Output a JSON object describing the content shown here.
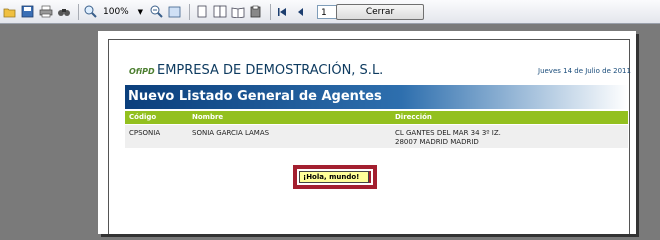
{
  "toolbar": {
    "zoom": "100%",
    "page_number": "1",
    "close_label": "Cerrar"
  },
  "report": {
    "logo_text": "OfiPD",
    "company": "EMPRESA DE DEMOSTRACIÓN, S.L.",
    "date": "Jueves 14 de Julio de 2011",
    "title": "Nuevo Listado General de Agentes",
    "columns": [
      "Código",
      "Nombre",
      "Dirección"
    ],
    "rows": [
      {
        "codigo": "CPSONIA",
        "nombre": "SONIA GARCIA LAMAS",
        "direccion_1": "CL GANTES DEL MAR 34 3º IZ.",
        "direccion_2": "28007 MADRID MADRID"
      }
    ],
    "greeting": "¡Hola, mundo!"
  },
  "colors": {
    "title_bar": "#0b3f7c",
    "header_row": "#93c01f",
    "highlight_frame": "#a31f2f",
    "greeting_bg": "#ffff99"
  }
}
